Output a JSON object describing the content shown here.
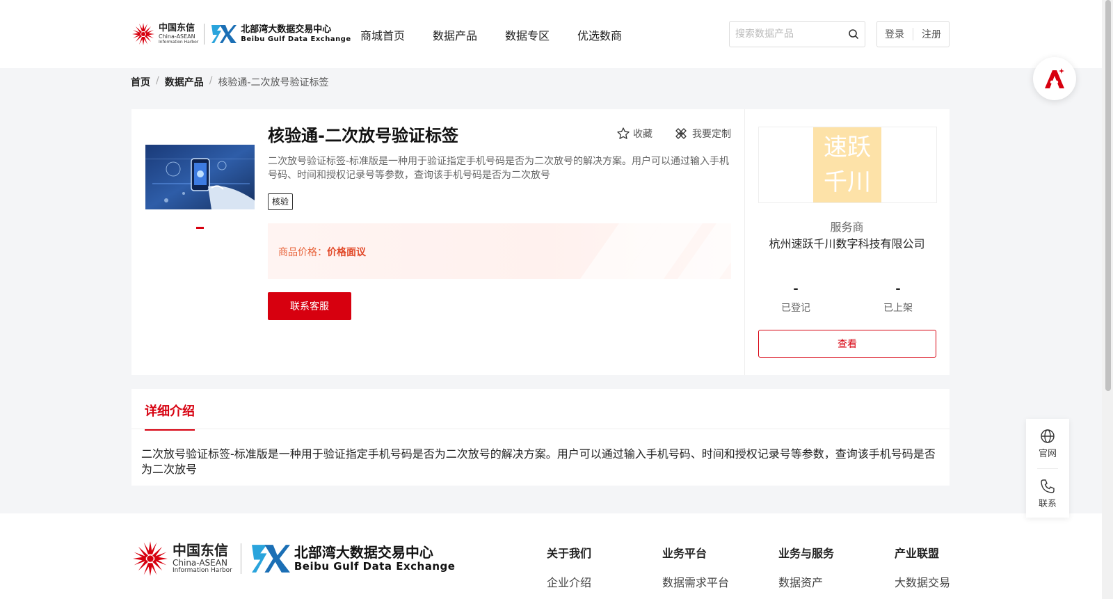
{
  "header": {
    "logo_cn": {
      "line1": "中国东信",
      "line2": "China-ASEAN",
      "line3": "Information Harbor"
    },
    "logo_bb": {
      "line1": "北部湾大数据交易中心",
      "line2": "Beibu Gulf Data Exchange"
    },
    "nav": [
      "商城首页",
      "数据产品",
      "数据专区",
      "优选数商"
    ],
    "search_placeholder": "搜索数据产品",
    "login": "登录",
    "register": "注册"
  },
  "breadcrumb": {
    "home": "首页",
    "category": "数据产品",
    "current": "核验通-二次放号验证标签"
  },
  "product": {
    "title": "核验通-二次放号验证标签",
    "favorite": "收藏",
    "customize": "我要定制",
    "description": "二次放号验证标签-标准版是一种用于验证指定手机号码是否为二次放号的解决方案。用户可以通过输入手机号码、时间和授权记录号等参数，查询该手机号码是否为二次放号",
    "tag": "核验",
    "price_label": "商品价格：",
    "price_value": "价格面议",
    "contact_button": "联系客服"
  },
  "vendor": {
    "logo_line1": "速跃",
    "logo_line2": "千川",
    "role": "服务商",
    "name": "杭州速跃千川数字科技有限公司",
    "registered_value": "-",
    "registered_label": "已登记",
    "listed_value": "-",
    "listed_label": "已上架",
    "view_button": "查看"
  },
  "detail": {
    "tab": "详细介绍",
    "text": "二次放号验证标签-标准版是一种用于验证指定手机号码是否为二次放号的解决方案。用户可以通过输入手机号码、时间和授权记录号等参数，查询该手机号码是否为二次放号"
  },
  "footer": {
    "columns": [
      {
        "title": "关于我们",
        "item": "企业介绍"
      },
      {
        "title": "业务平台",
        "item": "数据需求平台"
      },
      {
        "title": "业务与服务",
        "item": "数据资产"
      },
      {
        "title": "产业联盟",
        "item": "大数据交易"
      }
    ]
  },
  "side": {
    "website": "官网",
    "contact": "联系"
  },
  "colors": {
    "brand_red": "#d7000f",
    "price_orange": "#e8643b",
    "vendor_logo_bg": "#fde2a8"
  }
}
